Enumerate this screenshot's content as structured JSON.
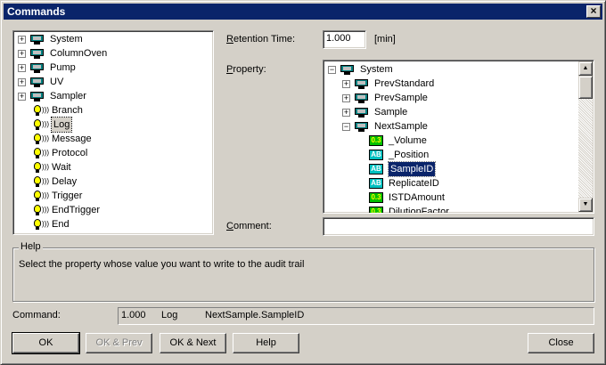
{
  "window": {
    "title": "Commands",
    "close_glyph": "×"
  },
  "commands_tree": {
    "items": [
      {
        "label": "System",
        "icon": "device-icon",
        "expander": "+"
      },
      {
        "label": "ColumnOven",
        "icon": "device-icon",
        "expander": "+"
      },
      {
        "label": "Pump",
        "icon": "device-icon",
        "expander": "+"
      },
      {
        "label": "UV",
        "icon": "device-icon",
        "expander": "+"
      },
      {
        "label": "Sampler",
        "icon": "device-icon",
        "expander": "+"
      },
      {
        "label": "Branch",
        "icon": "command-icon"
      },
      {
        "label": "Log",
        "icon": "command-icon",
        "selected": true
      },
      {
        "label": "Message",
        "icon": "command-icon"
      },
      {
        "label": "Protocol",
        "icon": "command-icon"
      },
      {
        "label": "Wait",
        "icon": "command-icon"
      },
      {
        "label": "Delay",
        "icon": "command-icon"
      },
      {
        "label": "Trigger",
        "icon": "command-icon"
      },
      {
        "label": "EndTrigger",
        "icon": "command-icon"
      },
      {
        "label": "End",
        "icon": "command-icon"
      }
    ]
  },
  "retention": {
    "label_underlined": "R",
    "label_rest": "etention Time:",
    "value": "1.000",
    "unit": "[min]"
  },
  "property": {
    "label_underlined": "P",
    "label_rest": "roperty:",
    "items": [
      {
        "label": "System",
        "icon": "device-icon",
        "expander": "−"
      },
      {
        "label": "PrevStandard",
        "icon": "device-icon",
        "expander": "+"
      },
      {
        "label": "PrevSample",
        "icon": "device-icon",
        "expander": "+"
      },
      {
        "label": "Sample",
        "icon": "device-icon",
        "expander": "+"
      },
      {
        "label": "NextSample",
        "icon": "device-icon",
        "expander": "−"
      },
      {
        "label": "_Volume",
        "icon": "numeric-icon",
        "icon_text": "0.3"
      },
      {
        "label": "_Position",
        "icon": "text-icon",
        "icon_text": "AB"
      },
      {
        "label": "SampleID",
        "icon": "text-icon",
        "icon_text": "AB",
        "selected": true
      },
      {
        "label": "ReplicateID",
        "icon": "text-icon",
        "icon_text": "AB"
      },
      {
        "label": "ISTDAmount",
        "icon": "numeric-icon",
        "icon_text": "0.3"
      },
      {
        "label": "DilutionFactor",
        "icon": "numeric-icon",
        "icon_text": "0.3"
      }
    ]
  },
  "comment": {
    "label_underlined": "C",
    "label_rest": "omment:",
    "value": ""
  },
  "help": {
    "title": "Help",
    "text": "Select the property whose value you want to write to the audit trail"
  },
  "command": {
    "label": "Command:",
    "time": "1.000",
    "name": "Log",
    "argument": "NextSample.SampleID"
  },
  "buttons": {
    "ok": "OK",
    "ok_prev": "OK & Prev",
    "ok_next": "OK & Next",
    "help": "Help",
    "close": "Close"
  },
  "colors": {
    "titlebar": "#0a246a",
    "face": "#d4d0c8",
    "selection": "#0a246a"
  }
}
